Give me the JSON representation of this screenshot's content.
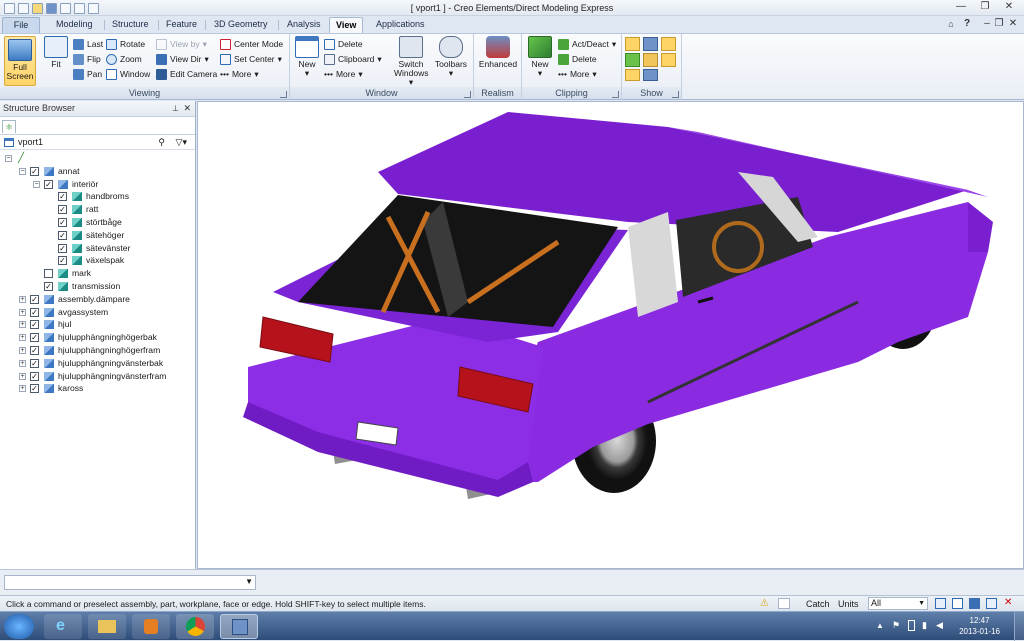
{
  "window": {
    "title": "[ vport1 ] - Creo Elements/Direct Modeling Express",
    "help": "?"
  },
  "tabs": [
    "File",
    "Modeling",
    "Structure",
    "Feature",
    "3D Geometry",
    "Analysis",
    "View",
    "Applications"
  ],
  "active_tab": "View",
  "ribbon": {
    "full_screen": [
      "Full",
      "Screen"
    ],
    "fit": "Fit",
    "last": "Last",
    "flip": "Flip",
    "pan": "Pan",
    "rotate": "Rotate",
    "zoom": "Zoom",
    "window_tool": "Window",
    "view_by": "View by",
    "view_dir": "View Dir",
    "edit_camera": "Edit Camera",
    "center_mode": "Center Mode",
    "set_center": "Set Center",
    "more_viewing": "More",
    "new_window": "New",
    "delete_window": "Delete",
    "clipboard": "Clipboard",
    "more_window": "More",
    "switch_windows": [
      "Switch",
      "Windows"
    ],
    "toolbars": "Toolbars",
    "enhanced": "Enhanced",
    "new_clip": "New",
    "act_deact": "Act/Deact",
    "delete_clip": "Delete",
    "more_clip": "More",
    "groups": {
      "viewing": "Viewing",
      "window": "Window",
      "realism": "Realism",
      "clipping": "Clipping",
      "show": "Show"
    }
  },
  "browser": {
    "title": "Structure Browser",
    "root": "vport1",
    "nodes": [
      {
        "label": "annat",
        "level": 1,
        "exp": "−",
        "checked": true,
        "icon": "assembly"
      },
      {
        "label": "interiör",
        "level": 2,
        "exp": "−",
        "checked": true,
        "icon": "assembly"
      },
      {
        "label": "handbroms",
        "level": 3,
        "checked": true,
        "icon": "part"
      },
      {
        "label": "ratt",
        "level": 3,
        "checked": true,
        "icon": "part"
      },
      {
        "label": "störtbåge",
        "level": 3,
        "checked": true,
        "icon": "part"
      },
      {
        "label": "sätehöger",
        "level": 3,
        "checked": true,
        "icon": "part"
      },
      {
        "label": "sätevänster",
        "level": 3,
        "checked": true,
        "icon": "part"
      },
      {
        "label": "växelspak",
        "level": 3,
        "checked": true,
        "icon": "part"
      },
      {
        "label": "mark",
        "level": 2,
        "checked": false,
        "icon": "part"
      },
      {
        "label": "transmission",
        "level": 2,
        "checked": true,
        "icon": "part"
      },
      {
        "label": "assembly.dämpare",
        "level": 1,
        "exp": "+",
        "checked": true,
        "icon": "assembly"
      },
      {
        "label": "avgassystem",
        "level": 1,
        "exp": "+",
        "checked": true,
        "icon": "assembly"
      },
      {
        "label": "hjul",
        "level": 1,
        "exp": "+",
        "checked": true,
        "icon": "assembly"
      },
      {
        "label": "hjulupphängninghögerbak",
        "level": 1,
        "exp": "+",
        "checked": true,
        "icon": "assembly"
      },
      {
        "label": "hjulupphängninghögerfram",
        "level": 1,
        "exp": "+",
        "checked": true,
        "icon": "assembly"
      },
      {
        "label": "hjulupphängningvänsterbak",
        "level": 1,
        "exp": "+",
        "checked": true,
        "icon": "assembly"
      },
      {
        "label": "hjulupphängningvänsterfram",
        "level": 1,
        "exp": "+",
        "checked": true,
        "icon": "assembly"
      },
      {
        "label": "kaross",
        "level": 1,
        "exp": "+",
        "checked": true,
        "icon": "assembly"
      }
    ]
  },
  "status": {
    "message": "Click a command or preselect assembly, part, workplane, face or edge. Hold SHIFT-key to select multiple items.",
    "catch": "Catch",
    "units": "Units",
    "filter": "All"
  },
  "taskbar": {
    "time": "12:47",
    "date": "2013-01-16"
  },
  "colors": {
    "car_body": "#8a2be2",
    "car_roof": "#7a1fd0",
    "ribbon_active": "#ffd467"
  }
}
